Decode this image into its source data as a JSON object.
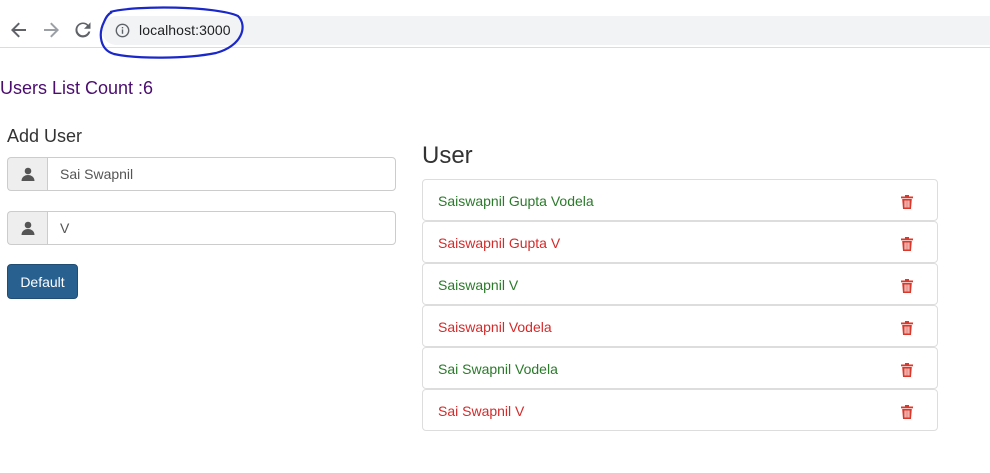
{
  "browser": {
    "url": "localhost:3000",
    "icons": {
      "back": "back-arrow-icon",
      "forward": "forward-arrow-icon",
      "reload": "reload-icon",
      "info": "info-icon"
    }
  },
  "page": {
    "count_heading": "Users List Count :6",
    "add_user_title": "Add User",
    "first_name_value": "Sai Swapnil",
    "last_name_value": "V",
    "default_button_label": "Default",
    "user_title": "User"
  },
  "users": [
    {
      "name": "Saiswapnil Gupta Vodela",
      "color": "#2a7a2a"
    },
    {
      "name": "Saiswapnil Gupta V",
      "color": "#d42a2a"
    },
    {
      "name": "Saiswapnil V",
      "color": "#2a7a2a"
    },
    {
      "name": "Saiswapnil Vodela",
      "color": "#d42a2a"
    },
    {
      "name": "Sai Swapnil Vodela",
      "color": "#2a7a2a"
    },
    {
      "name": "Sai Swapnil V",
      "color": "#d42a2a"
    }
  ],
  "colors": {
    "heading_purple": "#4b0d6e",
    "button_blue": "#286090",
    "trash_red": "#d9382b",
    "annotation_blue": "#1a27c9"
  }
}
